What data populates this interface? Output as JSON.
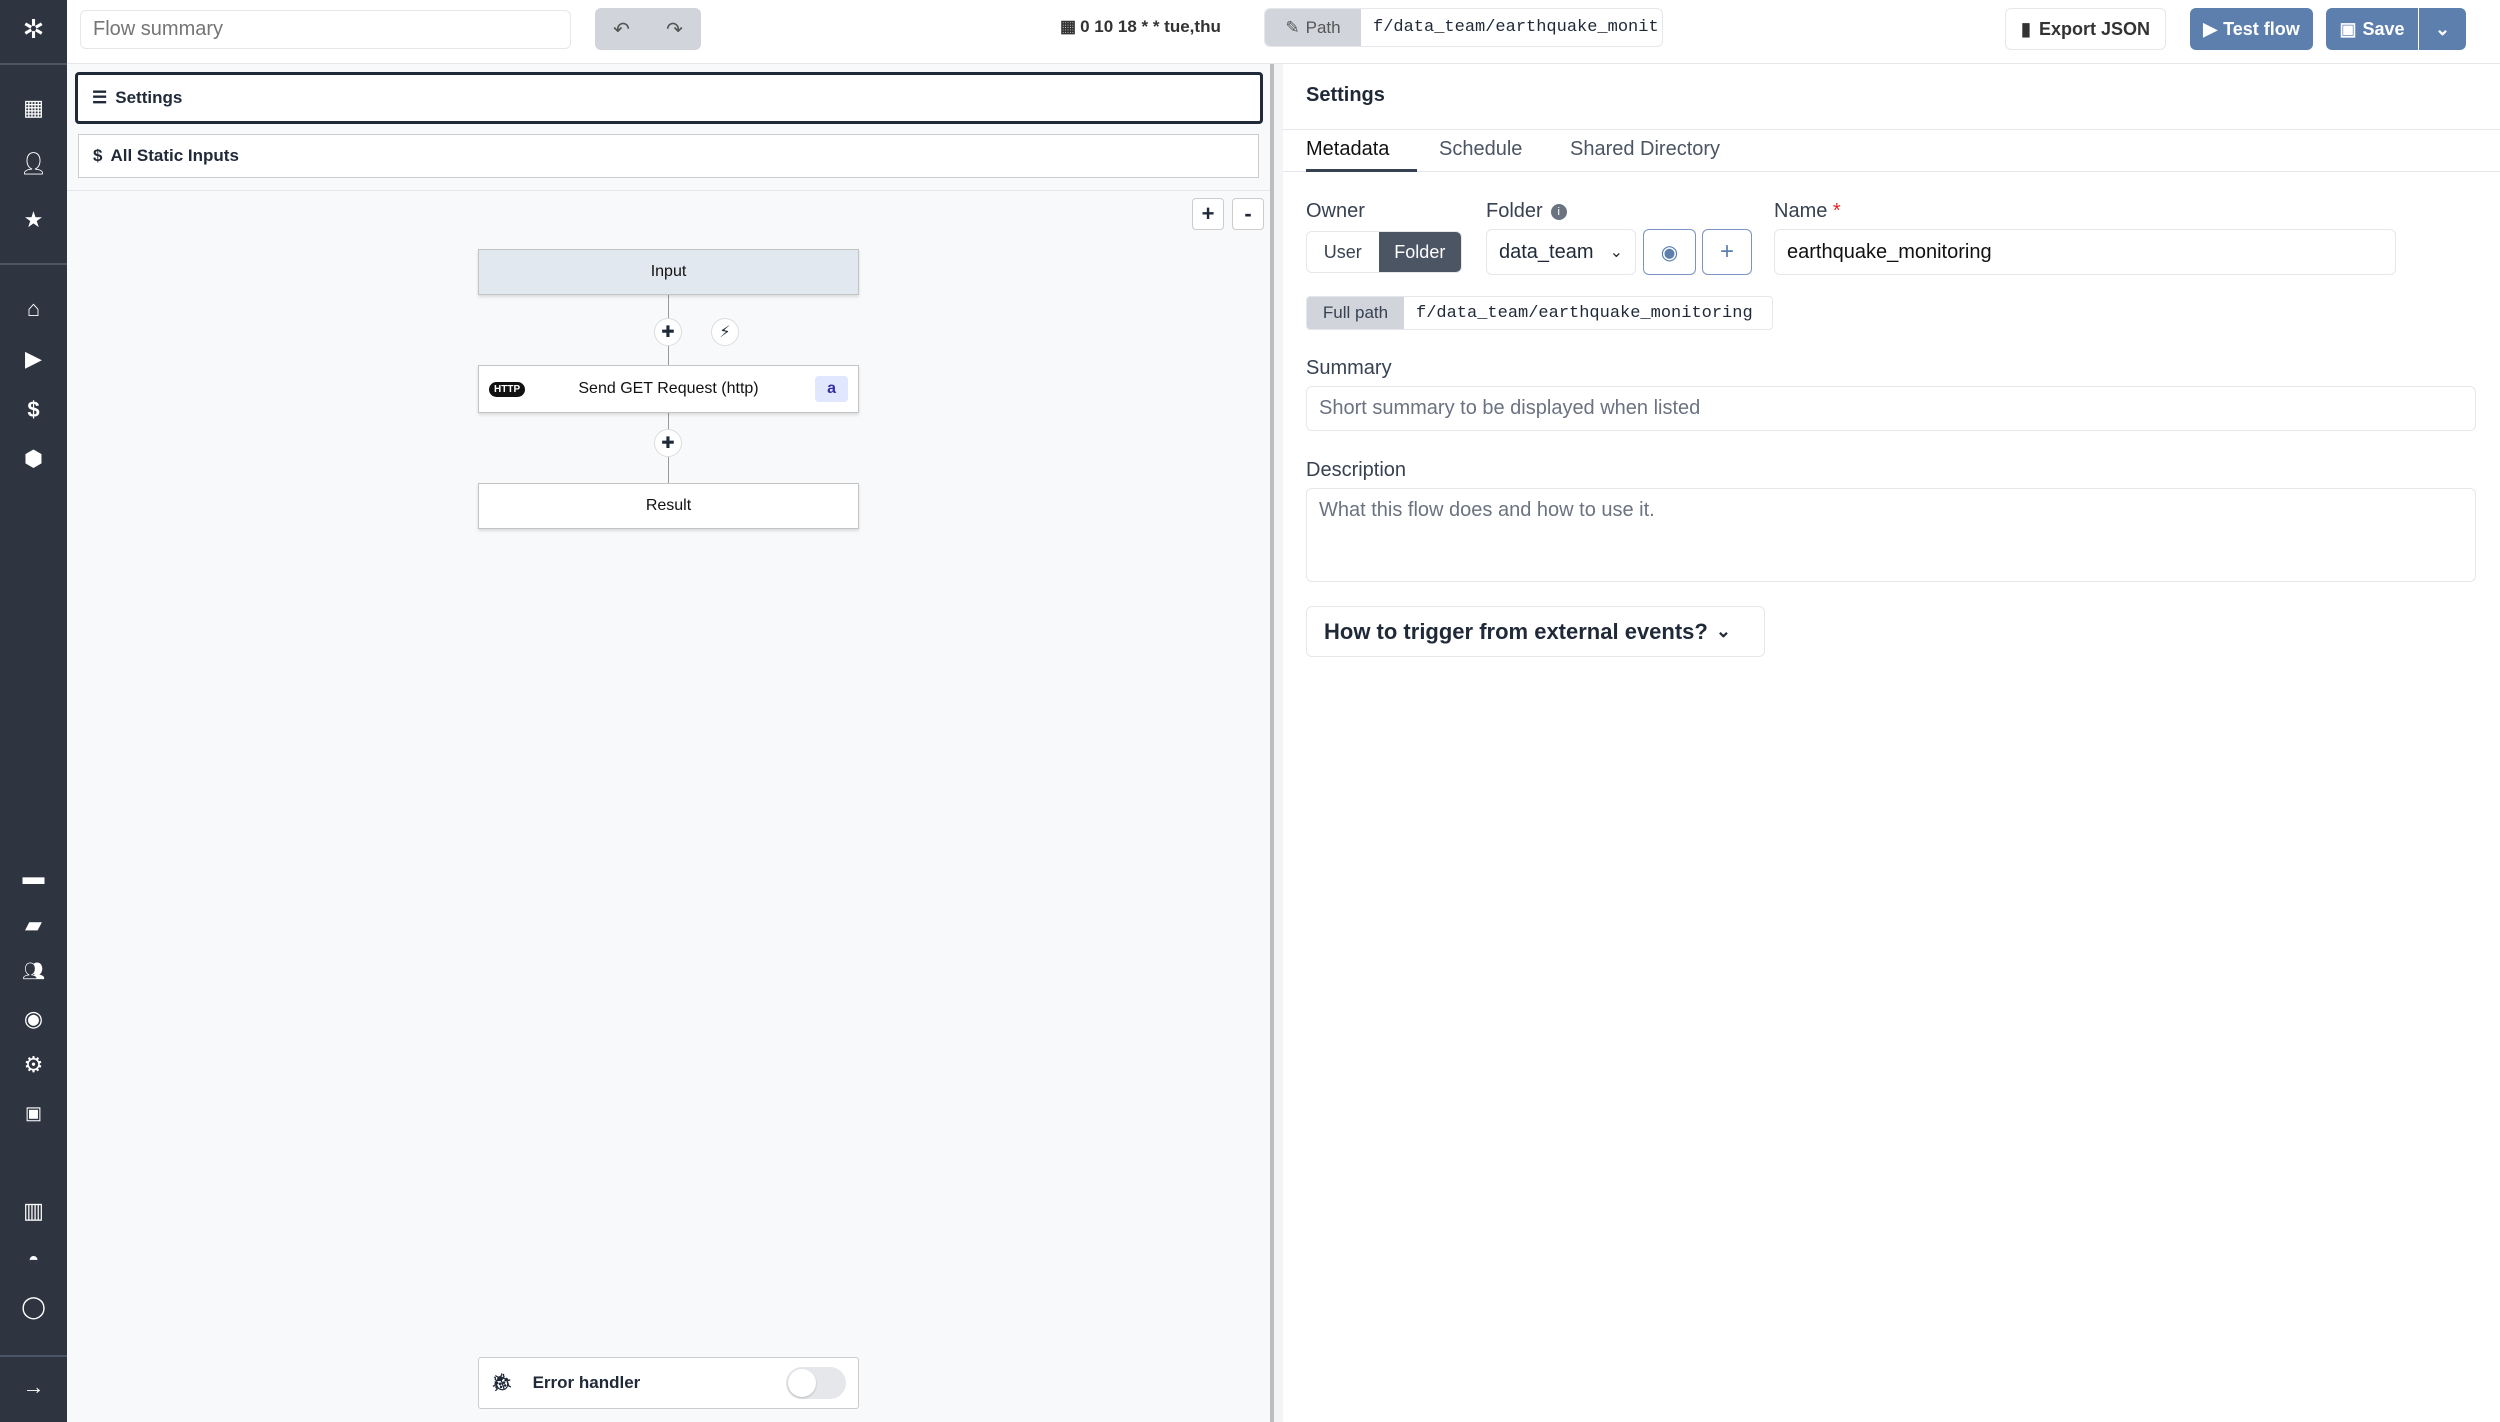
{
  "sidebar": {
    "items": [
      "logo-icon",
      "building-icon",
      "user-icon",
      "star-icon",
      "home-icon",
      "play-icon",
      "dollar-icon",
      "cubes-icon",
      "calendar-icon",
      "folder-open-icon",
      "users-gear-icon",
      "eye-icon",
      "gear-icon",
      "robot-icon",
      "book-icon",
      "discord-icon",
      "github-icon",
      "arrow-right-icon"
    ]
  },
  "toolbar": {
    "summary_placeholder": "Flow summary",
    "schedule": "0 10 18 * * tue,thu",
    "path_label": "Path",
    "path_value": "f/data_team/earthquake_monit",
    "export": "Export JSON",
    "test": "Test flow",
    "save": "Save"
  },
  "left": {
    "settings": "Settings",
    "static_inputs": "All Static Inputs",
    "zoom_in": "+",
    "zoom_out": "-",
    "nodes": {
      "input": "Input",
      "step": "Send GET Request (http)",
      "step_badge": "a",
      "result": "Result"
    },
    "error_handler": "Error handler",
    "error_handler_enabled": false
  },
  "right": {
    "title": "Settings",
    "tabs": [
      "Metadata",
      "Schedule",
      "Shared Directory"
    ],
    "active_tab": "Metadata",
    "owner_label": "Owner",
    "owner_options": [
      "User",
      "Folder"
    ],
    "owner_selected": "Folder",
    "folder_label": "Folder",
    "folder_value": "data_team",
    "name_label": "Name",
    "required": "*",
    "name_value": "earthquake_monitoring",
    "full_path_label": "Full path",
    "full_path": "f/data_team/earthquake_monitoring",
    "summary_label": "Summary",
    "summary_placeholder": "Short summary to be displayed when listed",
    "description_label": "Description",
    "description_placeholder": "What this flow does and how to use it.",
    "trigger": "How to trigger from external events?"
  },
  "colors": {
    "sidebar": "#2e3440",
    "accent": "#5c7fae",
    "owner_selected": "#4b5563"
  }
}
